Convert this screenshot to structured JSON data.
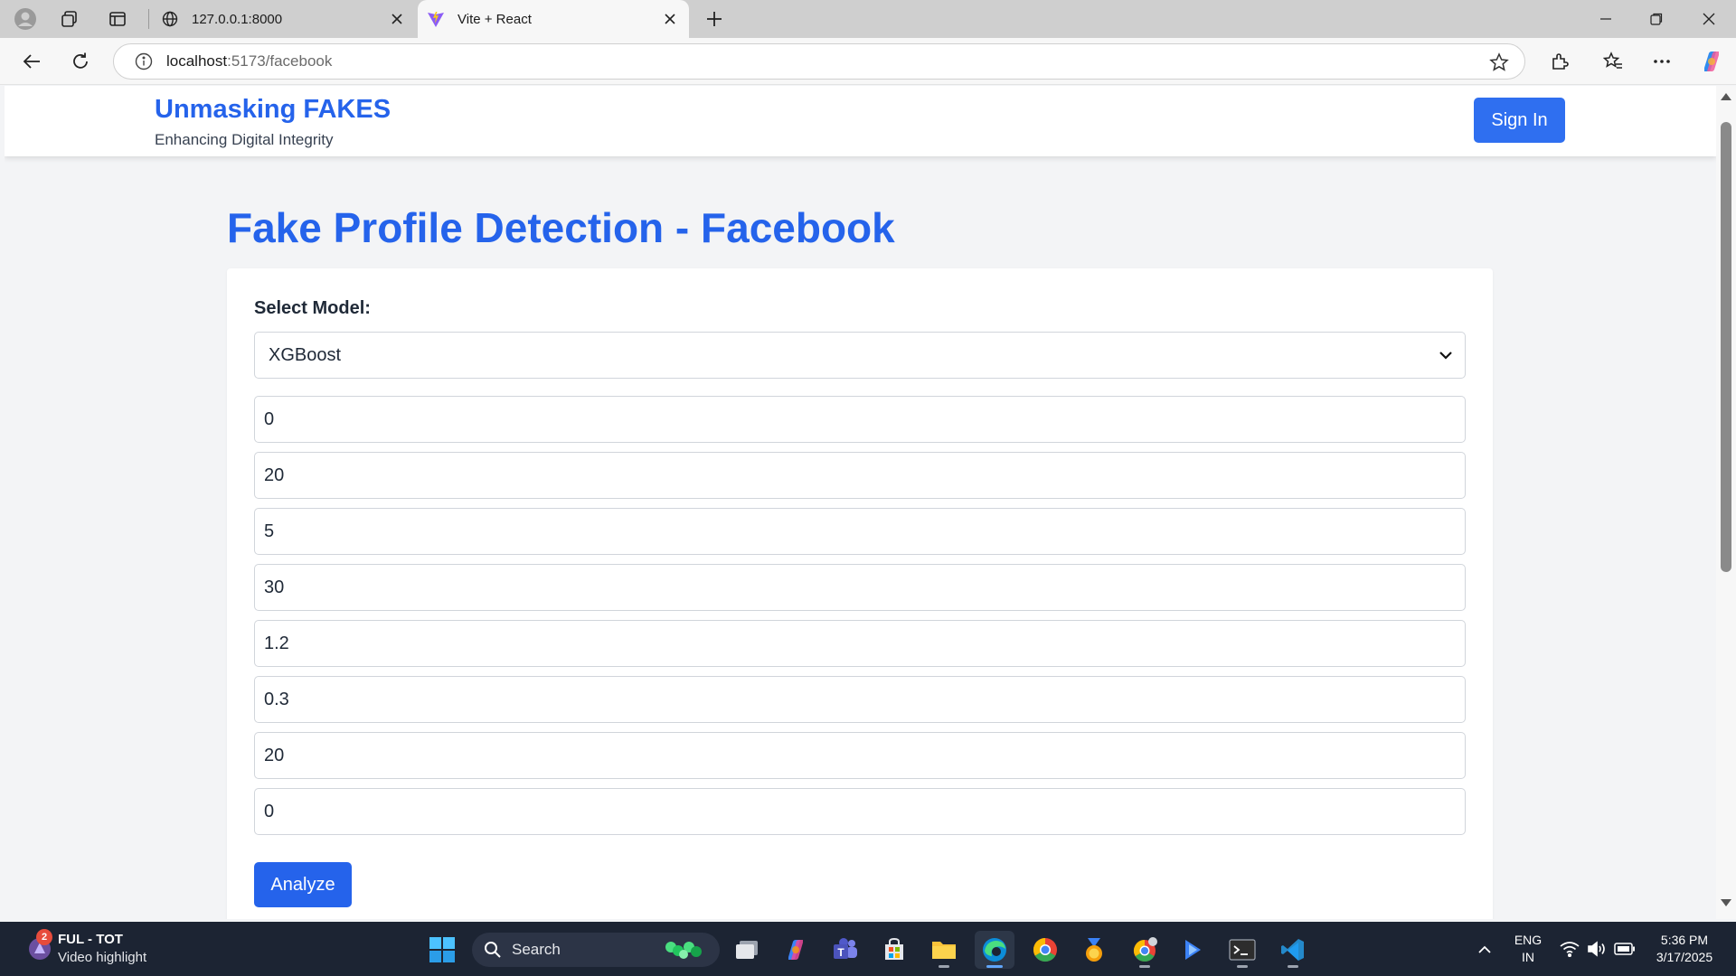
{
  "browser": {
    "tabs": [
      {
        "title": "127.0.0.1:8000",
        "active": false
      },
      {
        "title": "Vite + React",
        "active": true
      }
    ],
    "url": {
      "host": "localhost",
      "path": ":5173/facebook"
    }
  },
  "site": {
    "brand_title": "Unmasking FAKES",
    "brand_subtitle": "Enhancing Digital Integrity",
    "signin_label": "Sign In"
  },
  "page": {
    "title": "Fake Profile Detection - Facebook",
    "model_label": "Select Model:",
    "model_selected": "XGBoost",
    "fields": [
      "0",
      "20",
      "5",
      "30",
      "1.2",
      "0.3",
      "20",
      "0"
    ],
    "analyze_label": "Analyze"
  },
  "taskbar": {
    "news_badge": "2",
    "news_title": "FUL - TOT",
    "news_subtitle": "Video highlight",
    "search_label": "Search",
    "lang_line1": "ENG",
    "lang_line2": "IN",
    "time": "5:36 PM",
    "date": "3/17/2025"
  },
  "colors": {
    "brand_blue": "#2563eb",
    "signin_blue": "#2f6ff0",
    "taskbar_bg": "#1c2433"
  }
}
